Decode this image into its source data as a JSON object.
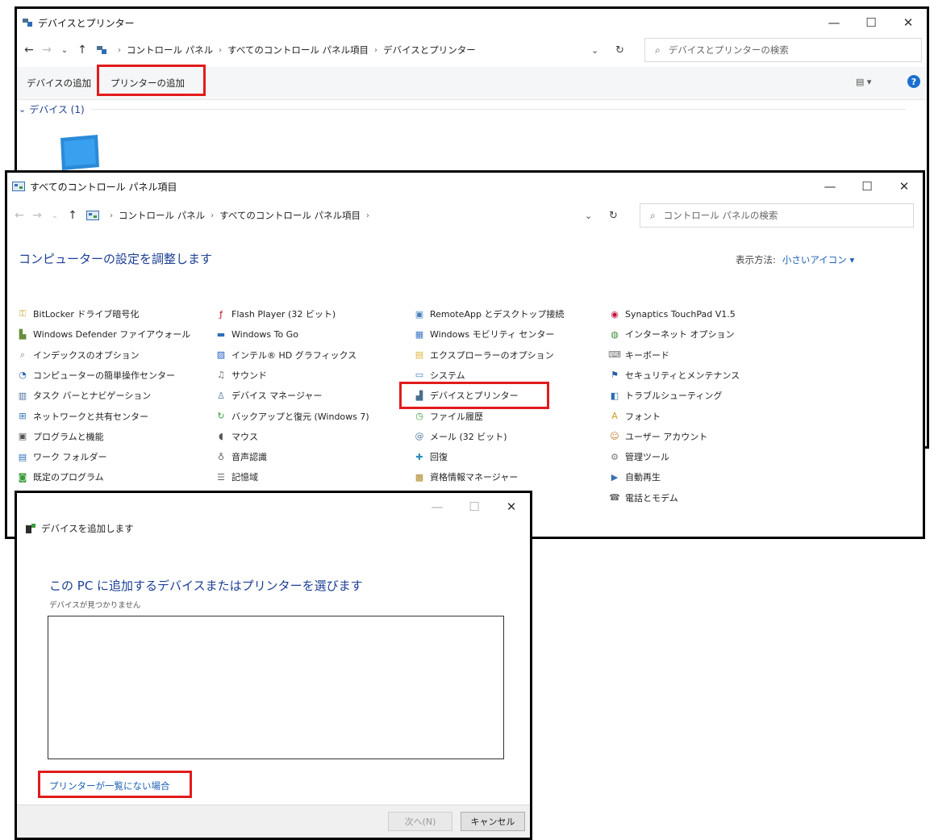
{
  "devices_window": {
    "title": "デバイスとプリンター",
    "controls": {
      "minimize": "—",
      "maximize": "☐",
      "close": "✕"
    },
    "nav": {
      "back": "←",
      "forward": "→",
      "recent": "⌄",
      "up": "↑"
    },
    "breadcrumb": [
      "コントロール パネル",
      "すべてのコントロール パネル項目",
      "デバイスとプリンター"
    ],
    "breadcrumb_sep": "›",
    "address_dropdown": "⌄",
    "refresh": "↻",
    "search_placeholder": "デバイスとプリンターの検索",
    "toolbar": {
      "add_device": "デバイスの追加",
      "add_printer": "プリンターの追加"
    },
    "view_icon": "▤ ▾",
    "help_icon": "?",
    "section_title": "デバイス (1)",
    "section_chevron": "⌄"
  },
  "control_panel_window": {
    "title": "すべてのコントロール パネル項目",
    "controls": {
      "minimize": "—",
      "maximize": "☐",
      "close": "✕"
    },
    "nav": {
      "back": "←",
      "forward": "→",
      "recent": "⌄",
      "up": "↑"
    },
    "breadcrumb": [
      "コントロール パネル",
      "すべてのコントロール パネル項目"
    ],
    "breadcrumb_sep": "›",
    "address_dropdown": "⌄",
    "refresh": "↻",
    "search_placeholder": "コントロール パネルの検索",
    "heading": "コンピューターの設定を調整します",
    "view_label": "表示方法:",
    "view_value": "小さいアイコン ▾",
    "items": [
      {
        "label": "BitLocker ドライブ暗号化",
        "icon": "key-icon",
        "color": "#c9a227",
        "glyph": "⚿"
      },
      {
        "label": "Flash Player (32 ビット)",
        "icon": "flash-icon",
        "color": "#b31217",
        "glyph": "ƒ"
      },
      {
        "label": "RemoteApp とデスクトップ接続",
        "icon": "remote-desktop-icon",
        "color": "#4a7fbf",
        "glyph": "▣"
      },
      {
        "label": "Synaptics TouchPad V1.5",
        "icon": "touchpad-icon",
        "color": "#c0143c",
        "glyph": "◉"
      },
      {
        "label": "Windows Defender ファイアウォール",
        "icon": "firewall-icon",
        "color": "#6a8e3a",
        "glyph": "▙"
      },
      {
        "label": "Windows To Go",
        "icon": "windows-to-go-icon",
        "color": "#2d6db5",
        "glyph": "▬"
      },
      {
        "label": "Windows モビリティ センター",
        "icon": "mobility-icon",
        "color": "#3b78c2",
        "glyph": "▦"
      },
      {
        "label": "インターネット オプション",
        "icon": "internet-options-icon",
        "color": "#3a8f3a",
        "glyph": "◍"
      },
      {
        "label": "インデックスのオプション",
        "icon": "indexing-icon",
        "color": "#6c7a8a",
        "glyph": "⌕"
      },
      {
        "label": "インテル® HD グラフィックス",
        "icon": "intel-graphics-icon",
        "color": "#1f5fbf",
        "glyph": "▧"
      },
      {
        "label": "エクスプローラーのオプション",
        "icon": "folder-options-icon",
        "color": "#e0b23a",
        "glyph": "▤"
      },
      {
        "label": "キーボード",
        "icon": "keyboard-icon",
        "color": "#777777",
        "glyph": "⌨"
      },
      {
        "label": "コンピューターの簡単操作センター",
        "icon": "ease-of-access-icon",
        "color": "#2b66b3",
        "glyph": "◔"
      },
      {
        "label": "サウンド",
        "icon": "sound-icon",
        "color": "#666666",
        "glyph": "♫"
      },
      {
        "label": "システム",
        "icon": "system-icon",
        "color": "#3d7dca",
        "glyph": "▭"
      },
      {
        "label": "セキュリティとメンテナンス",
        "icon": "security-flag-icon",
        "color": "#2a5aa8",
        "glyph": "⚑"
      },
      {
        "label": "タスク バーとナビゲーション",
        "icon": "taskbar-icon",
        "color": "#4c6f9a",
        "glyph": "▥"
      },
      {
        "label": "デバイス マネージャー",
        "icon": "device-manager-icon",
        "color": "#4c6f9a",
        "glyph": "♙"
      },
      {
        "label": "デバイスとプリンター",
        "icon": "devices-printers-icon",
        "color": "#4a6f8f",
        "glyph": "▟"
      },
      {
        "label": "トラブルシューティング",
        "icon": "troubleshooting-icon",
        "color": "#2d6db5",
        "glyph": "◧"
      },
      {
        "label": "ネットワークと共有センター",
        "icon": "network-icon",
        "color": "#2d6db5",
        "glyph": "⊞"
      },
      {
        "label": "バックアップと復元 (Windows 7)",
        "icon": "backup-icon",
        "color": "#3c9c3c",
        "glyph": "↻"
      },
      {
        "label": "ファイル履歴",
        "icon": "file-history-icon",
        "color": "#3c9c3c",
        "glyph": "◷"
      },
      {
        "label": "フォント",
        "icon": "fonts-icon",
        "color": "#d19a1c",
        "glyph": "A"
      },
      {
        "label": "プログラムと機能",
        "icon": "programs-icon",
        "color": "#555555",
        "glyph": "▣"
      },
      {
        "label": "マウス",
        "icon": "mouse-icon",
        "color": "#555555",
        "glyph": "◖"
      },
      {
        "label": "メール (32 ビット)",
        "icon": "mail-icon",
        "color": "#5a7fa8",
        "glyph": "@"
      },
      {
        "label": "ユーザー アカウント",
        "icon": "user-accounts-icon",
        "color": "#c07a2a",
        "glyph": "☺"
      },
      {
        "label": "ワーク フォルダー",
        "icon": "work-folders-icon",
        "color": "#2d6db5",
        "glyph": "▤"
      },
      {
        "label": "音声認識",
        "icon": "microphone-icon",
        "color": "#666666",
        "glyph": "♁"
      },
      {
        "label": "回復",
        "icon": "recovery-icon",
        "color": "#2d8fbf",
        "glyph": "✚"
      },
      {
        "label": "管理ツール",
        "icon": "admin-tools-icon",
        "color": "#777777",
        "glyph": "⚙"
      },
      {
        "label": "既定のプログラム",
        "icon": "default-programs-icon",
        "color": "#3c9c3c",
        "glyph": "◙"
      },
      {
        "label": "記憶域",
        "icon": "storage-icon",
        "color": "#666666",
        "glyph": "☰"
      },
      {
        "label": "資格情報マネージャー",
        "icon": "credential-manager-icon",
        "color": "#b08a2a",
        "glyph": "▩"
      },
      {
        "label": "自動再生",
        "icon": "autoplay-icon",
        "color": "#3c6fb5",
        "glyph": "▶"
      },
      {
        "label": "",
        "icon": "partial-icon",
        "color": "#2d6db5",
        "glyph": "▦"
      },
      {
        "label": "",
        "icon": "partial-icon",
        "color": "#2d6db5",
        "glyph": "◍"
      },
      {
        "label": "",
        "icon": "partial-icon",
        "color": "#3c9c3c",
        "glyph": "▦"
      },
      {
        "label": "電話とモデム",
        "icon": "phone-modem-icon",
        "color": "#666666",
        "glyph": "☎"
      }
    ]
  },
  "add_device_dialog": {
    "controls": {
      "minimize": "—",
      "maximize": "☐",
      "close": "✕"
    },
    "title": "デバイスを追加します",
    "heading": "この PC に追加するデバイスまたはプリンターを選びます",
    "status": "デバイスが見つかりません",
    "printer_not_listed": "プリンターが一覧にない場合",
    "next_button": "次へ(N)",
    "cancel_button": "キャンセル"
  },
  "colors": {
    "highlight": "#e21b1b",
    "link": "#1a5fb4",
    "heading_blue": "#1c3f94",
    "toolbar_bg": "#f5f6f7"
  }
}
